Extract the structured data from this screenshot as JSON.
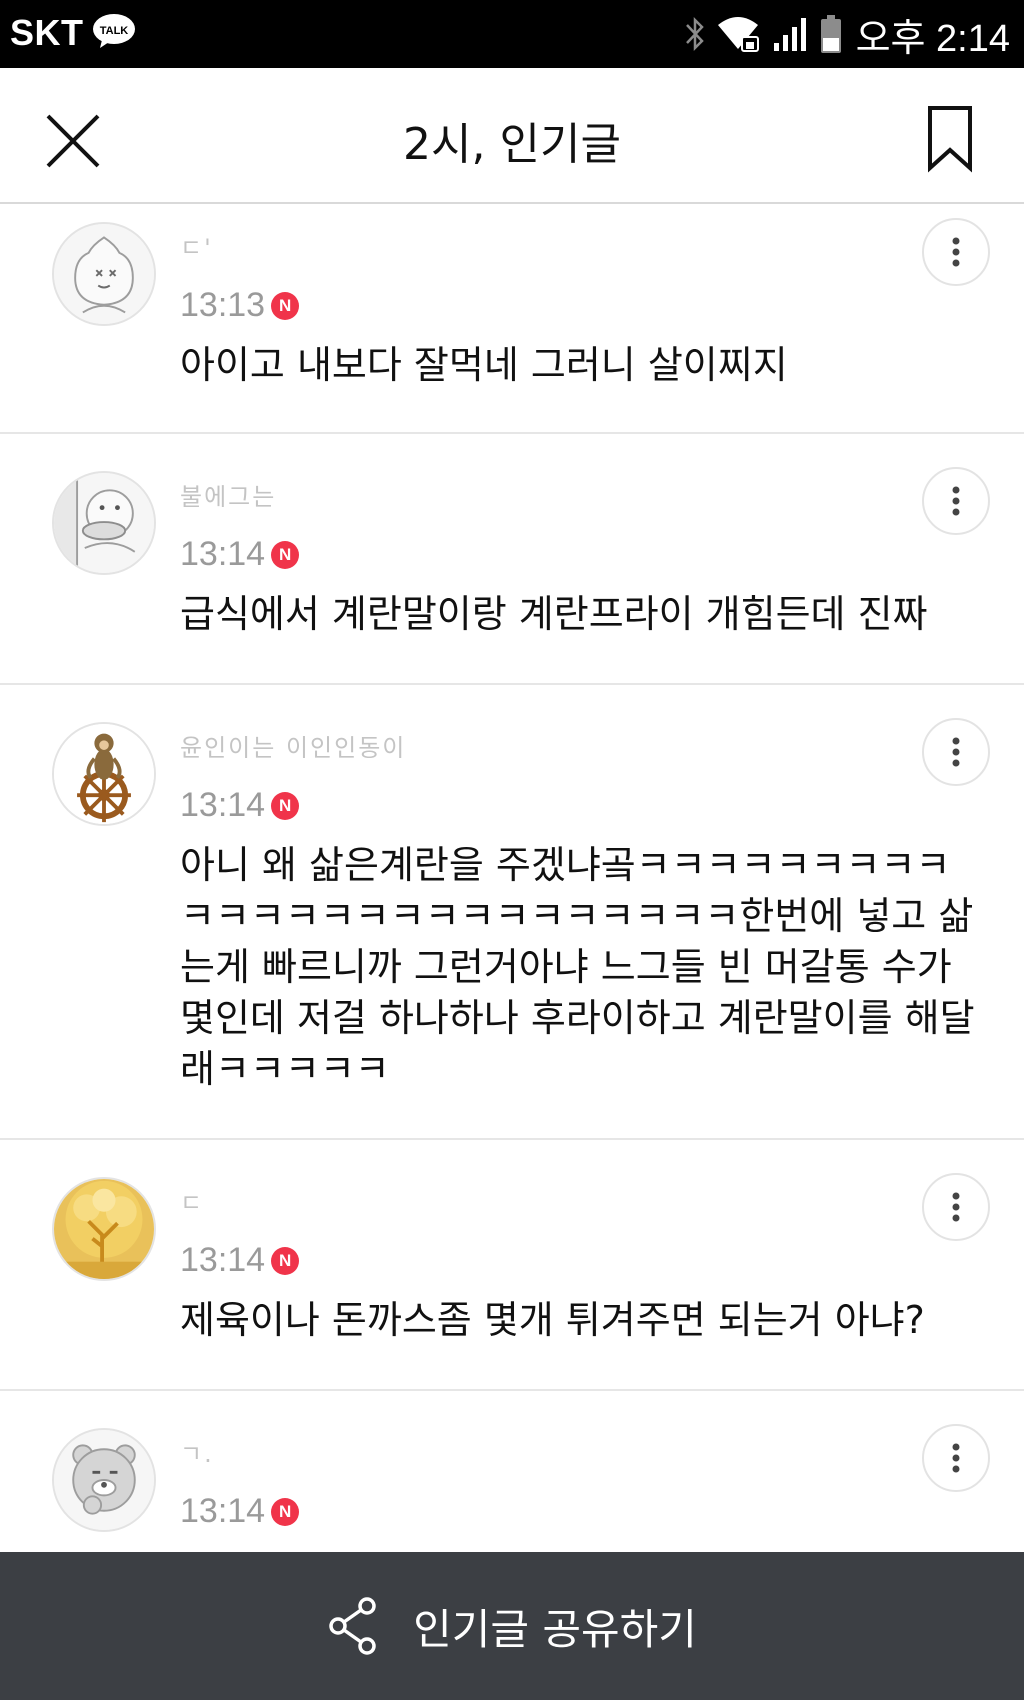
{
  "status_bar": {
    "carrier": "SKT",
    "talk_badge": "TALK",
    "time": "오후 2:14",
    "icons": [
      "bluetooth-icon",
      "wifi-lock-icon",
      "signal-icon",
      "battery-icon"
    ]
  },
  "header": {
    "title": "2시, 인기글",
    "close_icon": "close-icon",
    "bookmark_icon": "bookmark-icon"
  },
  "comments": [
    {
      "nickname": "ㄷ'",
      "time": "13:13",
      "badge": "N",
      "text": "아이고 내보다 잘먹네 그러니 살이찌지",
      "avatar": "peach-character"
    },
    {
      "nickname": "불에그는",
      "time": "13:14",
      "badge": "N",
      "text": "급식에서 계란말이랑 계란프라이 개힘든데 진짜",
      "avatar": "duck-character"
    },
    {
      "nickname": "윤인이는 이인인동이",
      "time": "13:14",
      "badge": "N",
      "text": "아니 왜 삶은계란을 주겠냐곸ㅋㅋㅋㅋㅋㅋㅋㅋㅋㅋㅋㅋㅋㅋㅋㅋㅋㅋㅋㅋㅋㅋㅋㅋㅋ한번에 넣고 삶는게 빠르니까 그런거아냐 느그들 빈 머갈통 수가 몇인데 저걸 하나하나 후라이하고 계란말이를 해달래ㅋㅋㅋㅋㅋ",
      "avatar": "monkey-ship-wheel"
    },
    {
      "nickname": "ㄷ",
      "time": "13:14",
      "badge": "N",
      "text": "제육이나 돈까스좀 몇개 튀겨주면 되는거 아냐?",
      "avatar": "golden-tree"
    },
    {
      "nickname": "ㄱ.",
      "time": "13:14",
      "badge": "N",
      "text": "",
      "avatar": "bear-character"
    }
  ],
  "share_bar": {
    "label": "인기글 공유하기",
    "icon": "share-icon"
  },
  "colors": {
    "status_bg": "#000000",
    "share_bg": "#3c3f44",
    "new_badge": "#f0344a",
    "divider": "#e6e6e6",
    "time_text": "#9a9a9a"
  }
}
